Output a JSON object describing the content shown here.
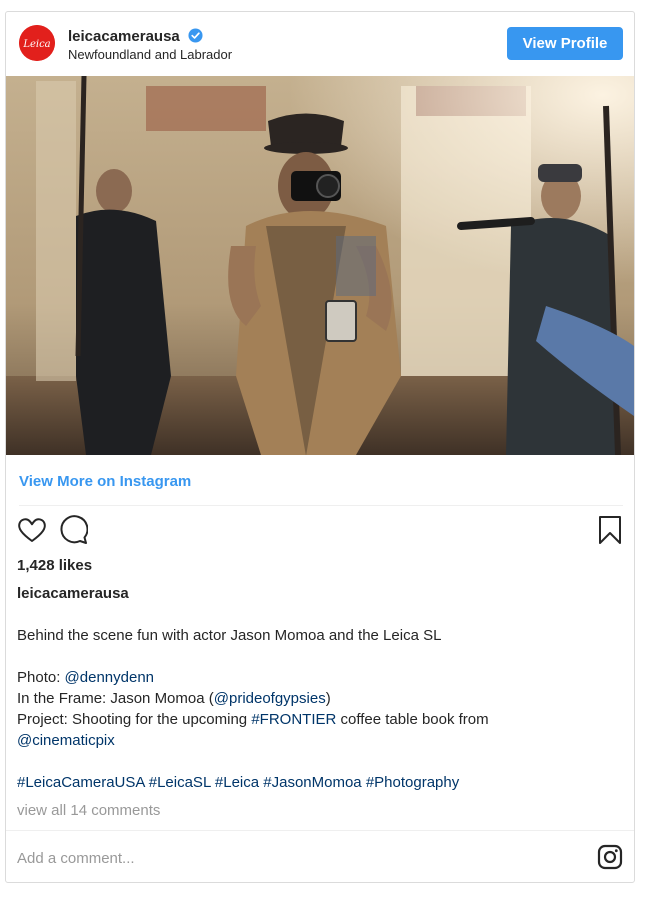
{
  "header": {
    "avatar_text": "Leica",
    "username": "leicacamerausa",
    "location": "Newfoundland and Labrador",
    "view_profile_label": "View Profile"
  },
  "photo": {
    "description_icon": "photo"
  },
  "view_more_label": "View More on Instagram",
  "actions": {
    "like_icon": "heart-icon",
    "comment_icon": "comment-icon",
    "save_icon": "bookmark-icon"
  },
  "likes": "1,428 likes",
  "owner": "leicacamerausa",
  "caption": {
    "line1": "Behind the scene fun with actor Jason Momoa and the Leica SL",
    "photo_label": "Photo: ",
    "photo_handle": "@dennydenn",
    "frame_label": "In the Frame: Jason Momoa (",
    "frame_handle": "@prideofgypsies",
    "frame_close": ")",
    "project_label": "Project: Shooting for the upcoming ",
    "project_tag": "#FRONTIER",
    "project_rest": " coffee table book from",
    "project_handle": "@cinematicpix",
    "hashtags": "#LeicaCameraUSA #LeicaSL #Leica #JasonMomoa #Photography"
  },
  "comments_link": "view all 14 comments",
  "footer": {
    "add_comment_placeholder": "Add a comment...",
    "instagram_icon": "instagram-icon"
  },
  "colors": {
    "accent": "#3897f0",
    "link": "#003569",
    "muted": "#999999",
    "brand_red": "#e2201c"
  }
}
